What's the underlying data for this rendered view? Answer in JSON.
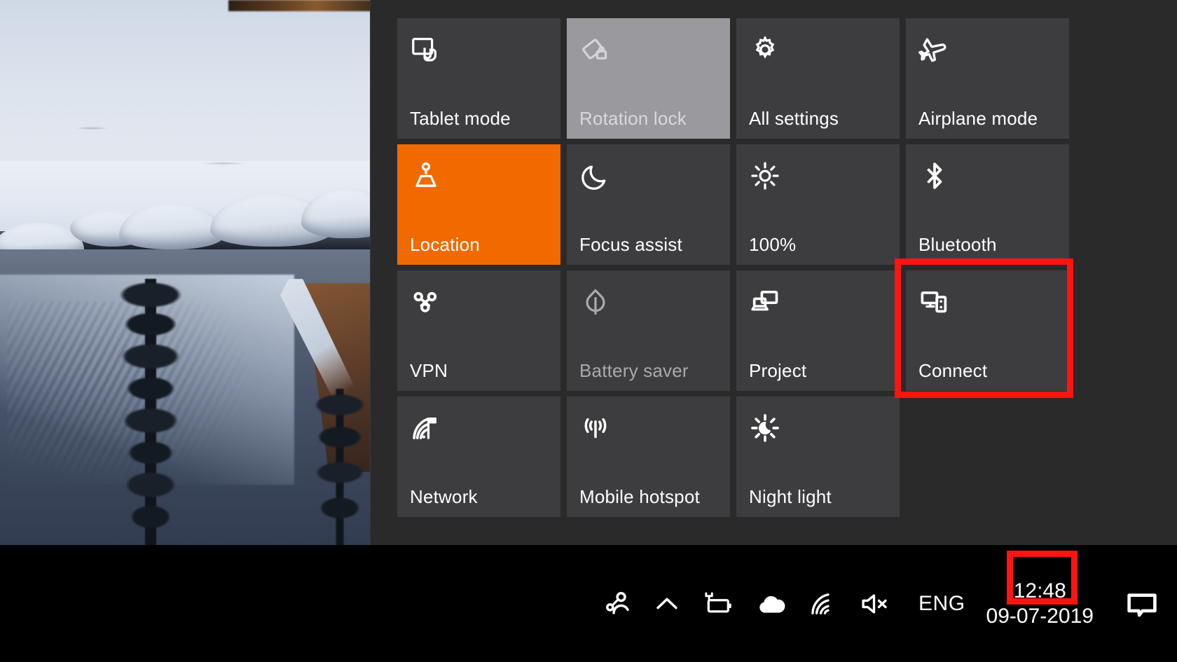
{
  "desktop": {
    "wallpaper_description": "winter lake scene with snow banks and mountain reflection"
  },
  "action_center": {
    "accent_color": "#f06a00",
    "panel_color": "#2a2a2a",
    "tile_color": "#3d3d40",
    "highlight_color": "#ff1412",
    "tiles": [
      {
        "label": "Tablet mode",
        "icon": "tablet-mode-icon",
        "state": "off"
      },
      {
        "label": "Rotation lock",
        "icon": "rotation-lock-icon",
        "state": "disabled"
      },
      {
        "label": "All settings",
        "icon": "gear-icon",
        "state": "off"
      },
      {
        "label": "Airplane mode",
        "icon": "airplane-icon",
        "state": "off"
      },
      {
        "label": "Location",
        "icon": "location-icon",
        "state": "active"
      },
      {
        "label": "Focus assist",
        "icon": "moon-icon",
        "state": "off"
      },
      {
        "label": "100%",
        "icon": "brightness-icon",
        "state": "off"
      },
      {
        "label": "Bluetooth",
        "icon": "bluetooth-icon",
        "state": "off"
      },
      {
        "label": "VPN",
        "icon": "vpn-icon",
        "state": "off"
      },
      {
        "label": "Battery saver",
        "icon": "leaf-icon",
        "state": "dim"
      },
      {
        "label": "Project",
        "icon": "project-icon",
        "state": "off"
      },
      {
        "label": "Connect",
        "icon": "connect-icon",
        "state": "off"
      },
      {
        "label": "Network",
        "icon": "network-wifi-icon",
        "state": "off"
      },
      {
        "label": "Mobile hotspot",
        "icon": "hotspot-icon",
        "state": "off"
      },
      {
        "label": "Night light",
        "icon": "night-light-icon",
        "state": "off"
      }
    ]
  },
  "taskbar": {
    "tray_icons": [
      {
        "name": "people-icon"
      },
      {
        "name": "chevron-up-icon"
      },
      {
        "name": "battery-charging-icon"
      },
      {
        "name": "onedrive-cloud-icon"
      },
      {
        "name": "wifi-icon"
      },
      {
        "name": "speaker-muted-icon"
      }
    ],
    "language": "ENG",
    "clock": {
      "time": "12:48",
      "date": "09-07-2019"
    },
    "notification_icon": "notification-bubble-icon"
  }
}
